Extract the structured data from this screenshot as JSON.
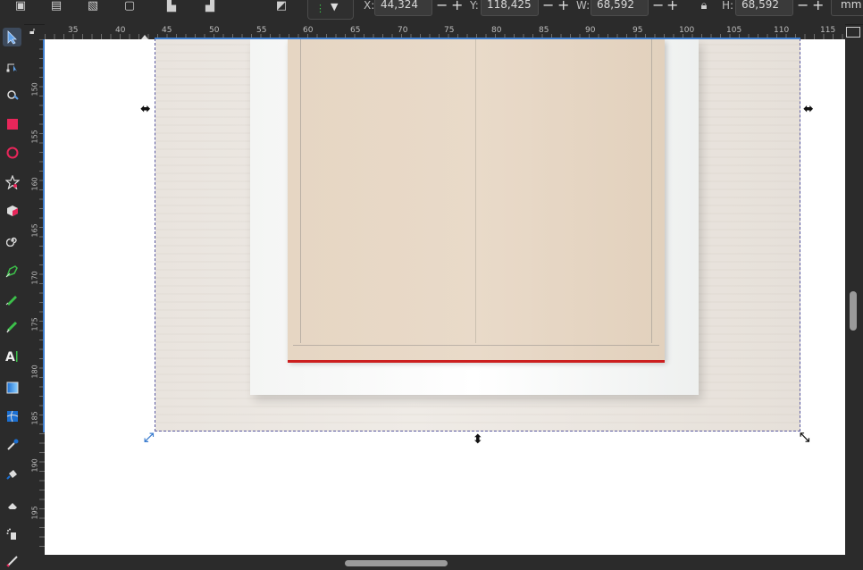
{
  "toolbar": {
    "x_label": "X:",
    "x_value": "44,324",
    "y_label": "Y:",
    "y_value": "118,425",
    "w_label": "W:",
    "w_value": "68,592",
    "h_label": "H:",
    "h_value": "68,592",
    "unit": "mm",
    "minus": "−",
    "plus": "+"
  },
  "hruler": {
    "labels": [
      "35",
      "40",
      "45",
      "50",
      "55",
      "60",
      "65",
      "70",
      "75",
      "80",
      "85",
      "90",
      "95",
      "100",
      "105",
      "110",
      "115"
    ]
  },
  "vruler": {
    "labels": [
      "150",
      "155",
      "160",
      "165",
      "170",
      "175",
      "180",
      "185",
      "190",
      "195"
    ]
  },
  "tools": [
    "selector-icon",
    "node-icon",
    "tweak-icon",
    "rectangle-icon",
    "ellipse-icon",
    "star-icon",
    "box3d-icon",
    "spiral-icon",
    "pen-icon",
    "pencil-icon",
    "calligraphy-icon",
    "text-icon",
    "gradient-icon",
    "mesh-icon",
    "dropper-icon",
    "paint-bucket-icon",
    "eraser-icon",
    "spray-icon",
    "measure-icon"
  ],
  "colors": {
    "accent": "#3f7fd0",
    "selection_line": "#cc1f1f"
  }
}
